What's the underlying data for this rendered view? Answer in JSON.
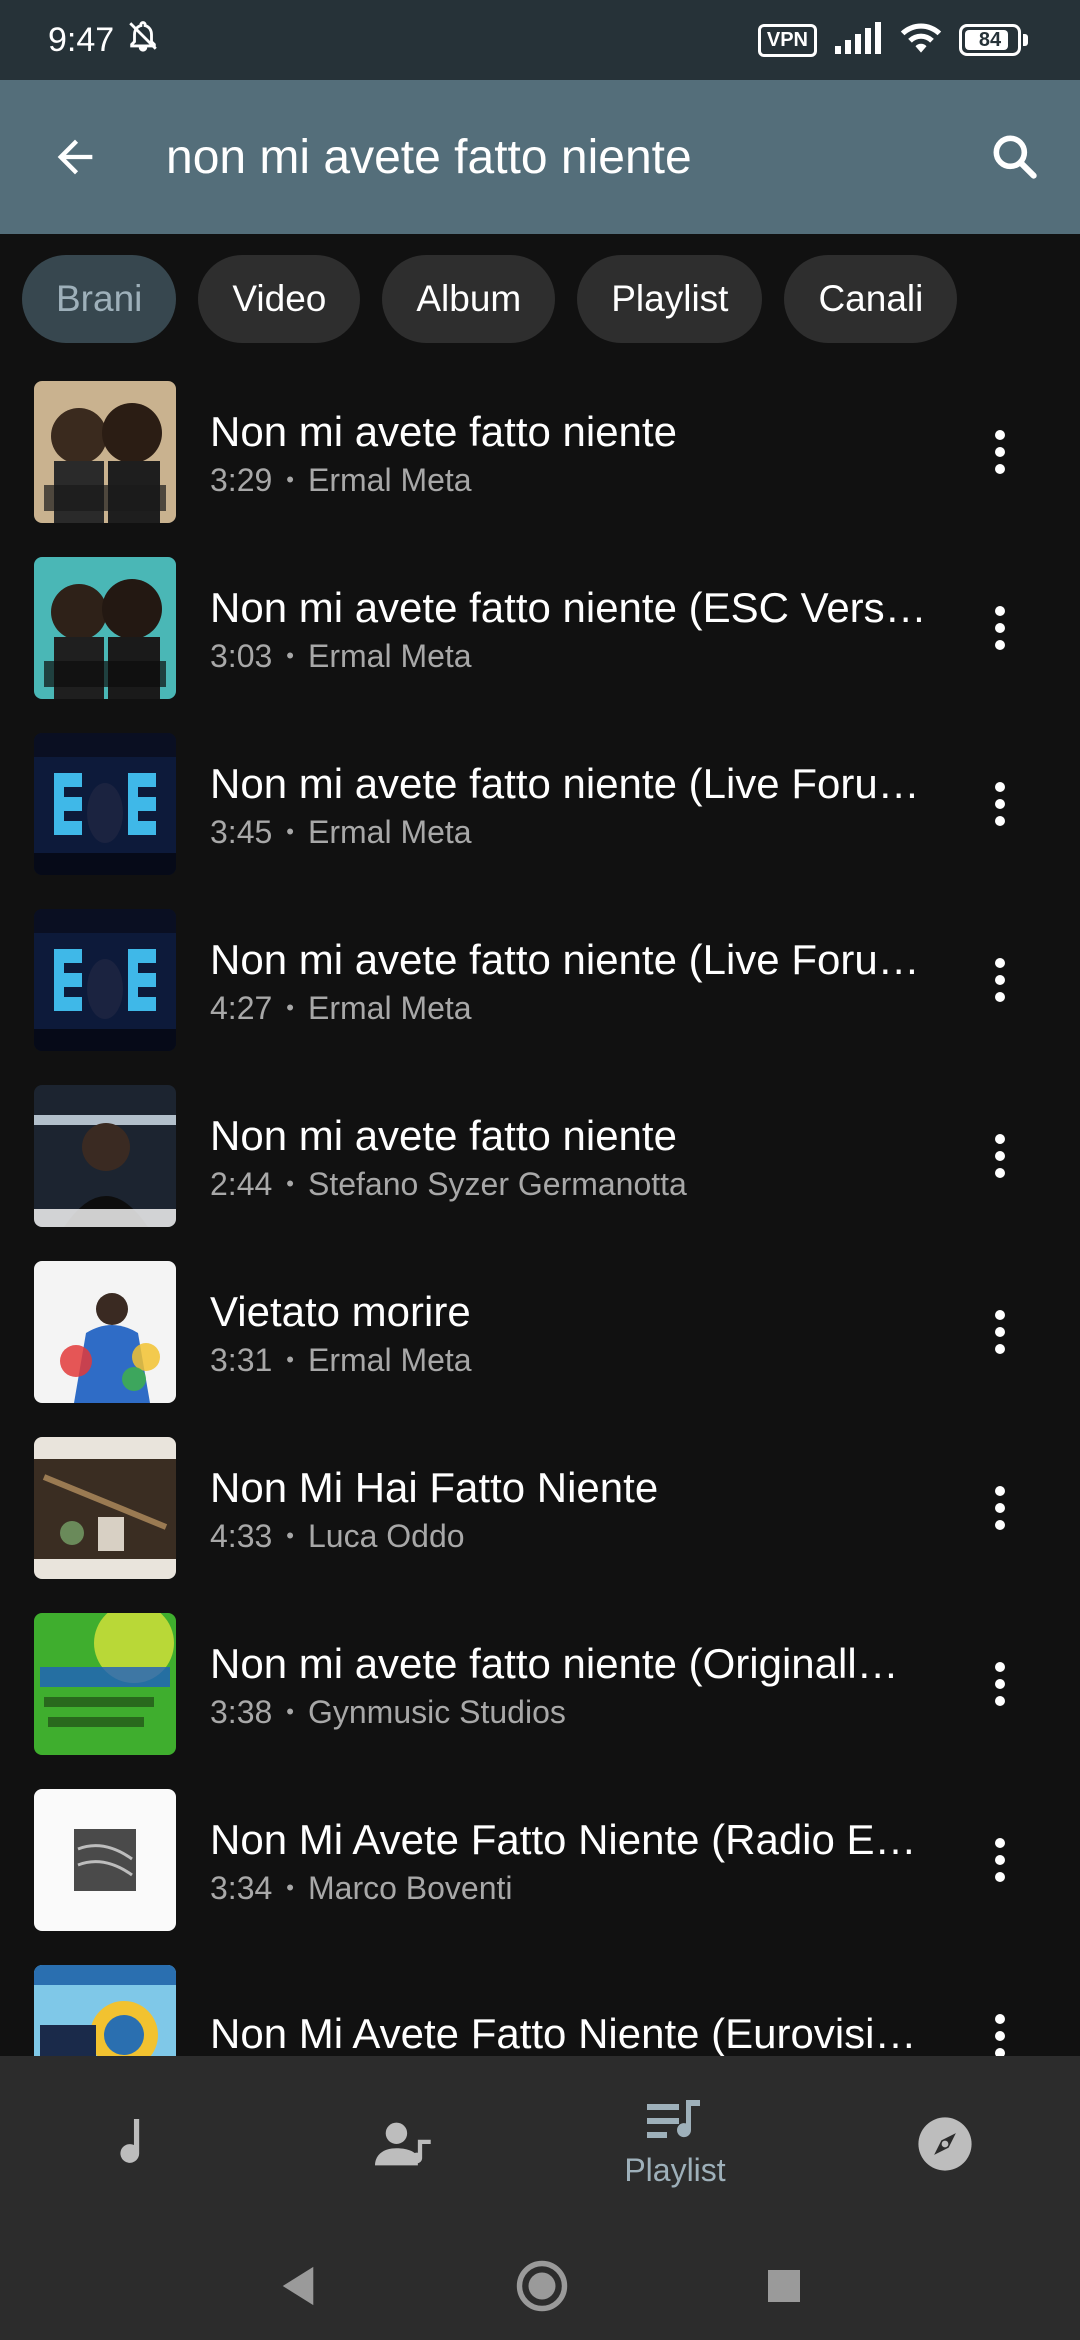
{
  "status_bar": {
    "time": "9:47",
    "vpn": "VPN",
    "battery": "84",
    "battery_level": 0.84
  },
  "app_bar": {
    "query": "non mi avete fatto niente"
  },
  "filters": [
    {
      "label": "Brani",
      "selected": true
    },
    {
      "label": "Video",
      "selected": false
    },
    {
      "label": "Album",
      "selected": false
    },
    {
      "label": "Playlist",
      "selected": false
    },
    {
      "label": "Canali",
      "selected": false
    }
  ],
  "results": [
    {
      "title": "Non mi avete fatto niente",
      "duration": "3:29",
      "artist": "Ermal Meta"
    },
    {
      "title": "Non mi avete fatto niente (ESC Vers…",
      "duration": "3:03",
      "artist": "Ermal Meta"
    },
    {
      "title": "Non mi avete fatto niente (Live Foru…",
      "duration": "3:45",
      "artist": "Ermal Meta"
    },
    {
      "title": "Non mi avete fatto niente (Live Foru…",
      "duration": "4:27",
      "artist": "Ermal Meta"
    },
    {
      "title": "Non mi avete fatto niente",
      "duration": "2:44",
      "artist": "Stefano Syzer Germanotta"
    },
    {
      "title": "Vietato morire",
      "duration": "3:31",
      "artist": "Ermal Meta"
    },
    {
      "title": "Non Mi Hai Fatto Niente",
      "duration": "4:33",
      "artist": "Luca Oddo"
    },
    {
      "title": "Non mi avete fatto niente (Originall…",
      "duration": "3:38",
      "artist": "Gynmusic Studios"
    },
    {
      "title": "Non Mi Avete Fatto Niente (Radio E…",
      "duration": "3:34",
      "artist": "Marco Boventi"
    },
    {
      "title": "Non Mi Avete Fatto Niente (Eurovisi…",
      "duration": "",
      "artist": ""
    }
  ],
  "bottom_nav": {
    "playlist_label": "Playlist"
  },
  "colors": {
    "status_bar": "#263238",
    "app_bar": "#546e7a",
    "background": "#111111",
    "accent": "#9eb0ba"
  }
}
